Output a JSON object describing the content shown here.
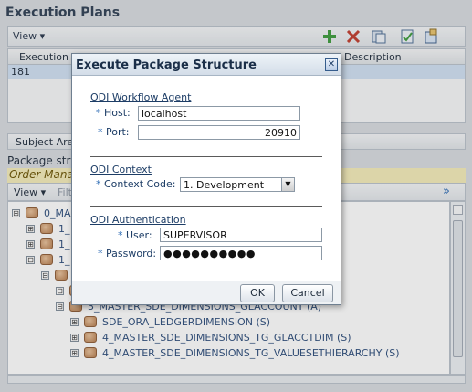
{
  "execution_plans": {
    "title": "Execution Plans",
    "view_label": "View",
    "chevron": "▾",
    "columns": [
      "Execution Pla",
      "Description"
    ],
    "rows": [
      {
        "id": "181"
      }
    ]
  },
  "subject_area_tab": "Subject Area",
  "package_structure_label": "Package stru",
  "order_manager_label": "Order Mana",
  "tree_view_label": "View",
  "tree_filter_label": "Filt",
  "tree_more_icon": "»",
  "tree": [
    {
      "label": "0_MAS",
      "expander": "⊟",
      "indent": 0
    },
    {
      "label": "1_",
      "expander": "⊞",
      "indent": 1
    },
    {
      "label": "1_",
      "expander": "⊞",
      "indent": 1
    },
    {
      "label": "1_",
      "expander": "⊟",
      "indent": 1
    },
    {
      "label": "",
      "expander": "⊟",
      "indent": 2
    },
    {
      "label": "",
      "expander": "⊟",
      "indent": 3
    },
    {
      "label": "3_MASTER_SDE_DIMENSIONS_GLACCOUNT (A)",
      "expander": "⊟",
      "indent": 3
    },
    {
      "label": "SDE_ORA_LEDGERDIMENSION (S)",
      "expander": "⊞",
      "indent": 4
    },
    {
      "label": "4_MASTER_SDE_DIMENSIONS_TG_GLACCTDIM (S)",
      "expander": "⊞",
      "indent": 4
    },
    {
      "label": "4_MASTER_SDE_DIMENSIONS_TG_VALUESETHIERARCHY (S)",
      "expander": "⊞",
      "indent": 4
    }
  ],
  "dialog": {
    "title": "Execute Package Structure",
    "close": "✕",
    "agent_section": "ODI Workflow Agent",
    "host_label": "Host:",
    "host_value": "localhost",
    "port_label": "Port:",
    "port_value": "20910",
    "context_section": "ODI Context",
    "context_label": "Context Code:",
    "context_value": "1. Development",
    "auth_section": "ODI Authentication",
    "user_label": "User:",
    "user_value": "SUPERVISOR",
    "password_label": "Password:",
    "password_value": "●●●●●●●●●●",
    "required_mark": "*",
    "ok_label": "OK",
    "cancel_label": "Cancel"
  },
  "colors": {
    "accent": "#2f6db5",
    "selected_row": "#cfe0f3",
    "order_bg": "#f4ecb8"
  }
}
